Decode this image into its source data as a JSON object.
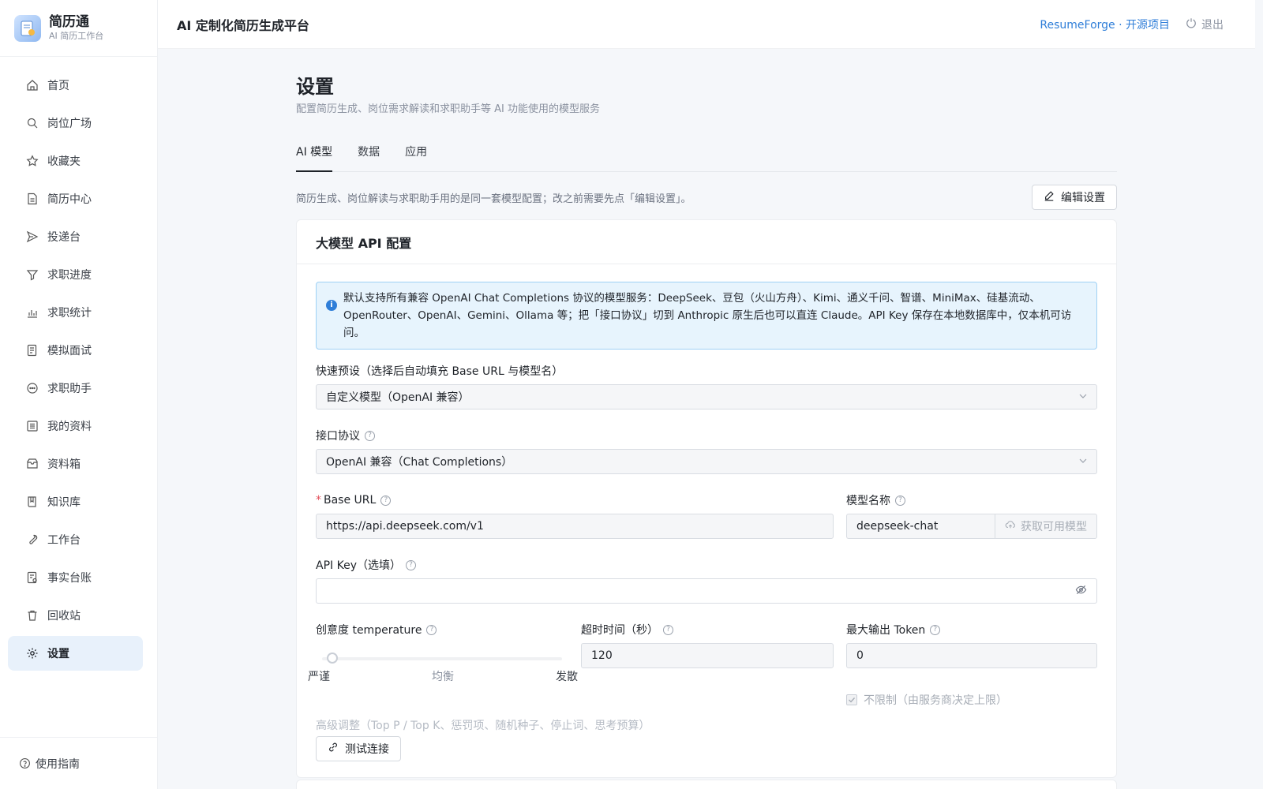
{
  "brand": {
    "name": "简历通",
    "subtitle": "AI 简历工作台"
  },
  "sidebar": {
    "items": [
      {
        "label": "首页",
        "icon": "home-icon"
      },
      {
        "label": "岗位广场",
        "icon": "search-icon"
      },
      {
        "label": "收藏夹",
        "icon": "star-icon"
      },
      {
        "label": "简历中心",
        "icon": "document-icon"
      },
      {
        "label": "投递台",
        "icon": "send-icon"
      },
      {
        "label": "求职进度",
        "icon": "funnel-icon"
      },
      {
        "label": "求职统计",
        "icon": "bar-chart-icon"
      },
      {
        "label": "模拟面试",
        "icon": "interview-icon"
      },
      {
        "label": "求职助手",
        "icon": "chat-icon"
      },
      {
        "label": "我的资料",
        "icon": "profile-icon"
      },
      {
        "label": "资料箱",
        "icon": "inbox-icon"
      },
      {
        "label": "知识库",
        "icon": "book-icon"
      },
      {
        "label": "工作台",
        "icon": "wrench-icon"
      },
      {
        "label": "事实台账",
        "icon": "ledger-icon"
      },
      {
        "label": "回收站",
        "icon": "trash-icon"
      },
      {
        "label": "设置",
        "icon": "gear-icon",
        "active": true
      }
    ],
    "footer_label": "使用指南"
  },
  "header": {
    "title": "AI 定制化简历生成平台",
    "link": "ResumeForge · 开源项目",
    "logout": "退出"
  },
  "page": {
    "title": "设置",
    "subtitle": "配置简历生成、岗位需求解读和求职助手等 AI 功能使用的模型服务",
    "tabs": [
      "AI 模型",
      "数据",
      "应用"
    ],
    "active_tab": "AI 模型",
    "notice": "简历生成、岗位解读与求职助手用的是同一套模型配置；改之前需要先点「编辑设置」。",
    "edit_button": "编辑设置"
  },
  "card": {
    "title": "大模型 API 配置",
    "alert_line1": "默认支持所有兼容 OpenAI Chat Completions 协议的模型服务：DeepSeek、豆包（火山方舟）、Kimi、通义千问、智谱、MiniMax、硅基流动、",
    "alert_line2": "OpenRouter、OpenAI、Gemini、Ollama 等；把「接口协议」切到 Anthropic 原生后也可以直连 Claude。API Key 保存在本地数据库中，仅本机可访问。",
    "preset_label": "快速预设（选择后自动填充 Base URL 与模型名）",
    "preset_value": "自定义模型（OpenAI 兼容）",
    "protocol_label": "接口协议",
    "protocol_value": "OpenAI 兼容（Chat Completions）",
    "base_url_label": "Base URL",
    "base_url_value": "https://api.deepseek.com/v1",
    "model_label": "模型名称",
    "model_value": "deepseek-chat",
    "fetch_models": "获取可用模型",
    "api_key_label": "API Key（选填）",
    "api_key_value": "",
    "temperature_label": "创意度 temperature",
    "temperature_marks": [
      "严谨",
      "均衡",
      "发散"
    ],
    "temperature_value": 0,
    "timeout_label": "超时时间（秒）",
    "timeout_value": "120",
    "max_tokens_label": "最大输出 Token",
    "max_tokens_value": "0",
    "unlimited_label": "不限制（由服务商决定上限）",
    "unlimited_checked": true,
    "advanced_label": "高级调整（Top P / Top K、惩罚项、随机种子、停止词、思考预算）",
    "test_button": "测试连接"
  },
  "colors": {
    "accent": "#2f7ed8",
    "active_bg": "#e8f1fb",
    "alert_bg": "#e7f4fd",
    "required": "#e34d59"
  }
}
